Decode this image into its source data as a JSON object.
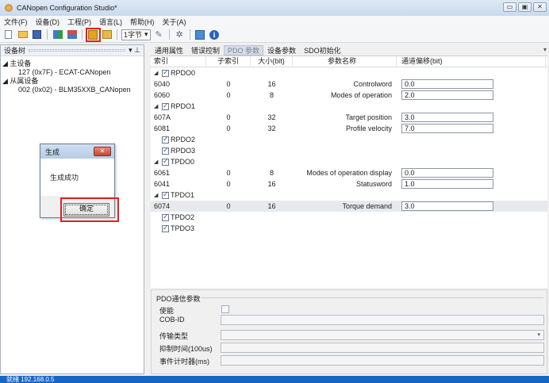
{
  "window": {
    "title": "CANopen Configuration Studio*",
    "buttons": [
      "▭",
      "▣",
      "✕"
    ]
  },
  "menu": [
    "文件(F)",
    "设备(D)",
    "工程(P)",
    "语言(L)",
    "帮助(H)",
    "关于(A)"
  ],
  "toolbar": {
    "byte_combo": "1字节"
  },
  "device_tree": {
    "title": "设备树",
    "pin": "▾ ⊥",
    "master_group": "主设备",
    "master_item": "127 (0x7F)  -  ECAT-CANopen",
    "slave_group": "从属设备",
    "slave_item": "002 (0x02)  -  BLM35XXB_CANopen"
  },
  "dialog": {
    "title": "生成",
    "message": "生成成功",
    "ok": "确定"
  },
  "tabs": [
    "通用属性",
    "错误控制",
    "PDO 参数",
    "设备参数",
    "SDO初始化"
  ],
  "grid": {
    "headers": {
      "index": "索引",
      "subindex": "子索引",
      "size": "大小(bit)",
      "name": "参数名称",
      "offset": "通道偏移(bit)"
    },
    "rows": [
      {
        "type": "group",
        "expanded": true,
        "label": "RPDO0"
      },
      {
        "type": "entry",
        "index": "6040",
        "sub": "0",
        "size": "16",
        "name": "Controlword",
        "offset": "0.0"
      },
      {
        "type": "entry",
        "index": "6060",
        "sub": "0",
        "size": "8",
        "name": "Modes of operation",
        "offset": "2.0"
      },
      {
        "type": "group",
        "expanded": true,
        "label": "RPDO1"
      },
      {
        "type": "entry",
        "index": "607A",
        "sub": "0",
        "size": "32",
        "name": "Target position",
        "offset": "3.0"
      },
      {
        "type": "entry",
        "index": "6081",
        "sub": "0",
        "size": "32",
        "name": "Profile velocity",
        "offset": "7.0"
      },
      {
        "type": "group",
        "expanded": false,
        "label": "RPDO2"
      },
      {
        "type": "group",
        "expanded": false,
        "label": "RPDO3"
      },
      {
        "type": "group",
        "expanded": true,
        "label": "TPDO0"
      },
      {
        "type": "entry",
        "index": "6061",
        "sub": "0",
        "size": "8",
        "name": "Modes of operation display",
        "offset": "0.0"
      },
      {
        "type": "entry",
        "index": "6041",
        "sub": "0",
        "size": "16",
        "name": "Statusword",
        "offset": "1.0"
      },
      {
        "type": "group",
        "expanded": true,
        "label": "TPDO1"
      },
      {
        "type": "entry",
        "index": "6074",
        "sub": "0",
        "size": "16",
        "name": "Torque demand",
        "offset": "3.0",
        "selected": true
      },
      {
        "type": "group",
        "expanded": false,
        "label": "TPDO2"
      },
      {
        "type": "group",
        "expanded": false,
        "label": "TPDO3"
      }
    ]
  },
  "pdo_params": {
    "legend": "PDO通信参数",
    "enable": "使能",
    "cob_id": "COB-ID",
    "transmission_type": "传输类型",
    "inhibit_time": "抑制时间(100us)",
    "event_timer": "事件计时器(ms)"
  },
  "status": {
    "text": "就绪    192.168.0.5"
  },
  "colors": {
    "highlight": "#e02020",
    "statusbar": "#1766c4"
  }
}
